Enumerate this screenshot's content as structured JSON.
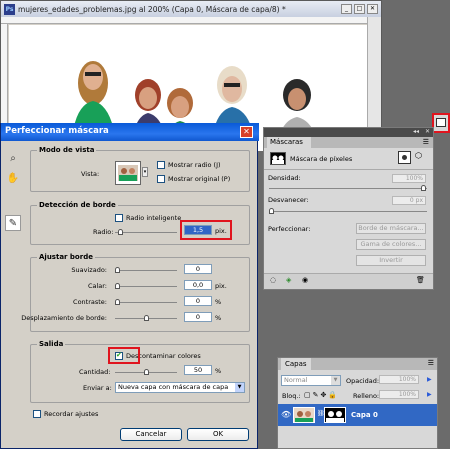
{
  "doc": {
    "title": "mujeres_edades_problemas.jpg al 200% (Capa 0, Máscara de capa/8) *",
    "min": "_",
    "max": "□",
    "close": "✕"
  },
  "dialog": {
    "title": "Perfeccionar máscara",
    "close": "✕",
    "modo_vista": {
      "title": "Modo de vista",
      "vista_label": "Vista:",
      "mostrar_radio": "Mostrar radio (J)",
      "mostrar_original": "Mostrar original (P)"
    },
    "deteccion": {
      "title": "Detección de borde",
      "radio_inteligente": "Radio inteligente",
      "radio_label": "Radio:",
      "radio_value": "1,5",
      "radio_unit": "pix.",
      "radio_slider": 0.05
    },
    "ajustar": {
      "title": "Ajustar borde",
      "rows": [
        {
          "label": "Suavizado:",
          "value": "0",
          "unit": "",
          "pos": 0.0
        },
        {
          "label": "Calar:",
          "value": "0,0",
          "unit": "pix.",
          "pos": 0.0
        },
        {
          "label": "Contraste:",
          "value": "0",
          "unit": "%",
          "pos": 0.0
        },
        {
          "label": "Desplazamiento de borde:",
          "value": "0",
          "unit": "%",
          "pos": 0.5
        }
      ]
    },
    "salida": {
      "title": "Salida",
      "descontaminar": "Descontaminar colores",
      "cantidad_label": "Cantidad:",
      "cantidad_value": "50",
      "cantidad_unit": "%",
      "cantidad_pos": 0.5,
      "enviar_label": "Enviar a:",
      "enviar_value": "Nueva capa con máscara de capa"
    },
    "recordar": "Recordar ajustes",
    "cancel": "Cancelar",
    "ok": "OK"
  },
  "mascaras": {
    "tab": "Máscaras",
    "pixel_mask": "Máscara de píxeles",
    "densidad_label": "Densidad:",
    "densidad_value": "100%",
    "desvanecer_label": "Desvanecer:",
    "desvanecer_value": "0 px",
    "perfeccionar_label": "Perfeccionar:",
    "borde_btn": "Borde de máscara...",
    "gama_btn": "Gama de colores...",
    "invertir_btn": "Invertir"
  },
  "capas": {
    "tab": "Capas",
    "mode": "Normal",
    "opacidad_label": "Opacidad:",
    "opacidad_value": "100%",
    "bloq_label": "Bloq.:",
    "relleno_label": "Relleno:",
    "relleno_value": "100%",
    "layer_name": "Capa 0"
  }
}
